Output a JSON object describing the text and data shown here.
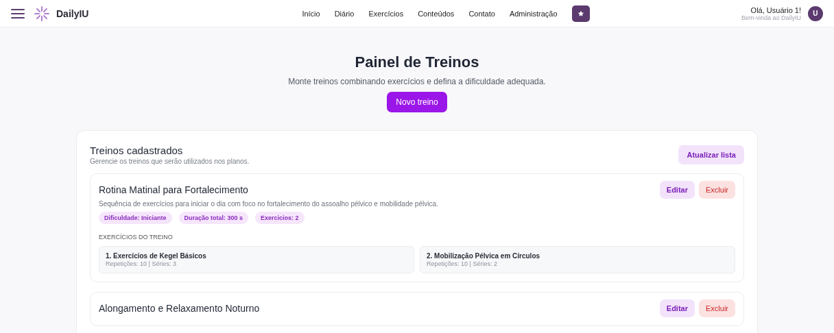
{
  "header": {
    "brand": "DailyIU",
    "nav": [
      "Início",
      "Diário",
      "Exercícios",
      "Conteúdos",
      "Contato",
      "Administração"
    ],
    "user": {
      "greeting": "Olá, Usuário 1!",
      "subtitle": "Bem-vinda ao DailyIU",
      "initial": "U"
    }
  },
  "hero": {
    "title": "Painel de Treinos",
    "subtitle": "Monte treinos combinando exercícios e defina a dificuldade adequada.",
    "button": "Novo treino"
  },
  "panel": {
    "title": "Treinos cadastrados",
    "subtitle": "Gerencie os treinos que serão utilizados nos planos.",
    "refresh": "Atualizar lista",
    "workouts": [
      {
        "title": "Rotina Matinal para Fortalecimento",
        "description": "Sequência de exercícios para iniciar o dia com foco no fortalecimento do assoalho pélvico e mobilidade pélvica.",
        "tags": [
          "Dificuldade: Iniciante",
          "Duração total: 300 s",
          "Exercicios: 2"
        ],
        "section": "EXERCÍCIOS DO TREINO",
        "exercises": [
          {
            "name": "1. Exercícios de Kegel Básicos",
            "detail": "Repetições: 10 | Séries: 3"
          },
          {
            "name": "2. Mobilização Pélvica em Círculos",
            "detail": "Repetições: 10 | Séries: 2"
          }
        ],
        "edit": "Editar",
        "delete": "Excluir"
      },
      {
        "title": "Alongamento e Relaxamento Noturno",
        "edit": "Editar",
        "delete": "Excluir"
      }
    ]
  }
}
